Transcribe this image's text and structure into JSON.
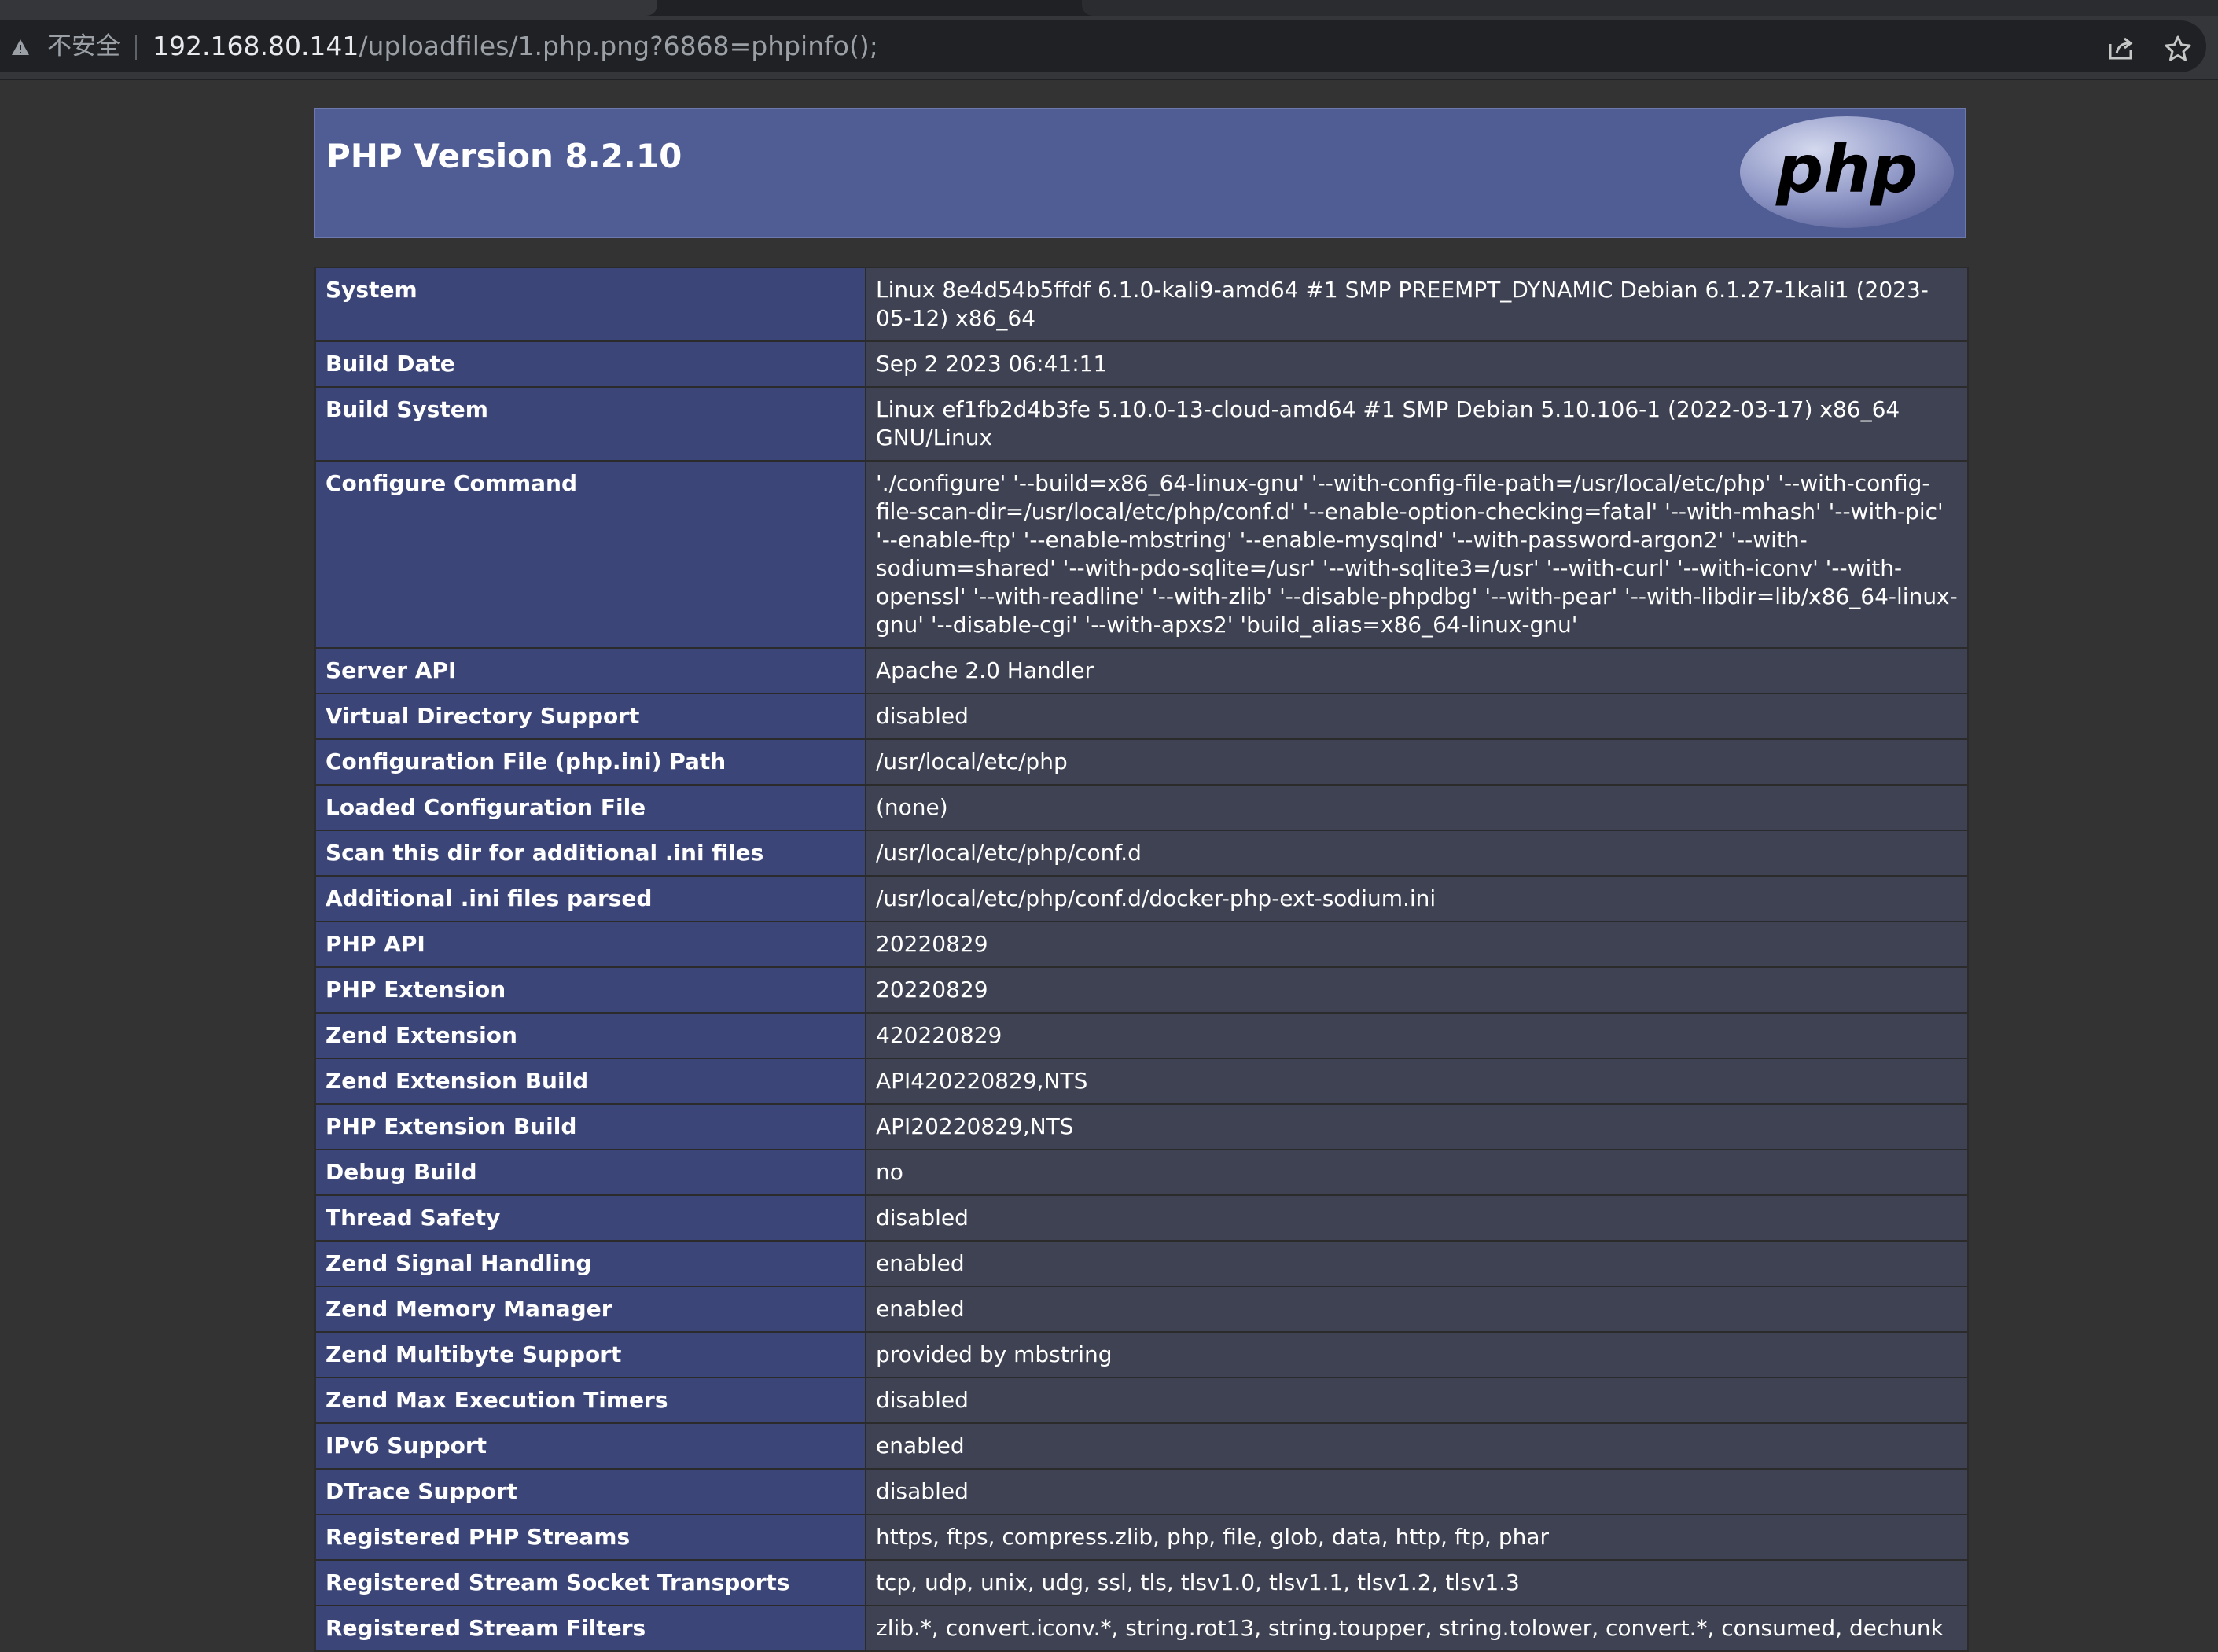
{
  "browser": {
    "security_label": "不安全",
    "url_host": "192.168.80.141",
    "url_path": "/uploadfiles/1.php.png?6868=phpinfo();"
  },
  "header": {
    "title": "PHP Version 8.2.10",
    "logo_text": "php"
  },
  "rows": [
    {
      "key": "System",
      "value": "Linux 8e4d54b5ffdf 6.1.0-kali9-amd64 #1 SMP PREEMPT_DYNAMIC Debian 6.1.27-1kali1 (2023-05-12) x86_64"
    },
    {
      "key": "Build Date",
      "value": "Sep 2 2023 06:41:11"
    },
    {
      "key": "Build System",
      "value": "Linux ef1fb2d4b3fe 5.10.0-13-cloud-amd64 #1 SMP Debian 5.10.106-1 (2022-03-17) x86_64 GNU/Linux"
    },
    {
      "key": "Configure Command",
      "value": "'./configure' '--build=x86_64-linux-gnu' '--with-config-file-path=/usr/local/etc/php' '--with-config-file-scan-dir=/usr/local/etc/php/conf.d' '--enable-option-checking=fatal' '--with-mhash' '--with-pic' '--enable-ftp' '--enable-mbstring' '--enable-mysqlnd' '--with-password-argon2' '--with-sodium=shared' '--with-pdo-sqlite=/usr' '--with-sqlite3=/usr' '--with-curl' '--with-iconv' '--with-openssl' '--with-readline' '--with-zlib' '--disable-phpdbg' '--with-pear' '--with-libdir=lib/x86_64-linux-gnu' '--disable-cgi' '--with-apxs2' 'build_alias=x86_64-linux-gnu'"
    },
    {
      "key": "Server API",
      "value": "Apache 2.0 Handler"
    },
    {
      "key": "Virtual Directory Support",
      "value": "disabled"
    },
    {
      "key": "Configuration File (php.ini) Path",
      "value": "/usr/local/etc/php"
    },
    {
      "key": "Loaded Configuration File",
      "value": "(none)"
    },
    {
      "key": "Scan this dir for additional .ini files",
      "value": "/usr/local/etc/php/conf.d"
    },
    {
      "key": "Additional .ini files parsed",
      "value": "/usr/local/etc/php/conf.d/docker-php-ext-sodium.ini"
    },
    {
      "key": "PHP API",
      "value": "20220829"
    },
    {
      "key": "PHP Extension",
      "value": "20220829"
    },
    {
      "key": "Zend Extension",
      "value": "420220829"
    },
    {
      "key": "Zend Extension Build",
      "value": "API420220829,NTS"
    },
    {
      "key": "PHP Extension Build",
      "value": "API20220829,NTS"
    },
    {
      "key": "Debug Build",
      "value": "no"
    },
    {
      "key": "Thread Safety",
      "value": "disabled"
    },
    {
      "key": "Zend Signal Handling",
      "value": "enabled"
    },
    {
      "key": "Zend Memory Manager",
      "value": "enabled"
    },
    {
      "key": "Zend Multibyte Support",
      "value": "provided by mbstring"
    },
    {
      "key": "Zend Max Execution Timers",
      "value": "disabled"
    },
    {
      "key": "IPv6 Support",
      "value": "enabled"
    },
    {
      "key": "DTrace Support",
      "value": "disabled"
    },
    {
      "key": "Registered PHP Streams",
      "value": "https, ftps, compress.zlib, php, file, glob, data, http, ftp, phar"
    },
    {
      "key": "Registered Stream Socket Transports",
      "value": "tcp, udp, unix, udg, ssl, tls, tlsv1.0, tlsv1.1, tlsv1.2, tlsv1.3"
    },
    {
      "key": "Registered Stream Filters",
      "value": "zlib.*, convert.iconv.*, string.rot13, string.toupper, string.tolower, convert.*, consumed, dechunk"
    }
  ]
}
